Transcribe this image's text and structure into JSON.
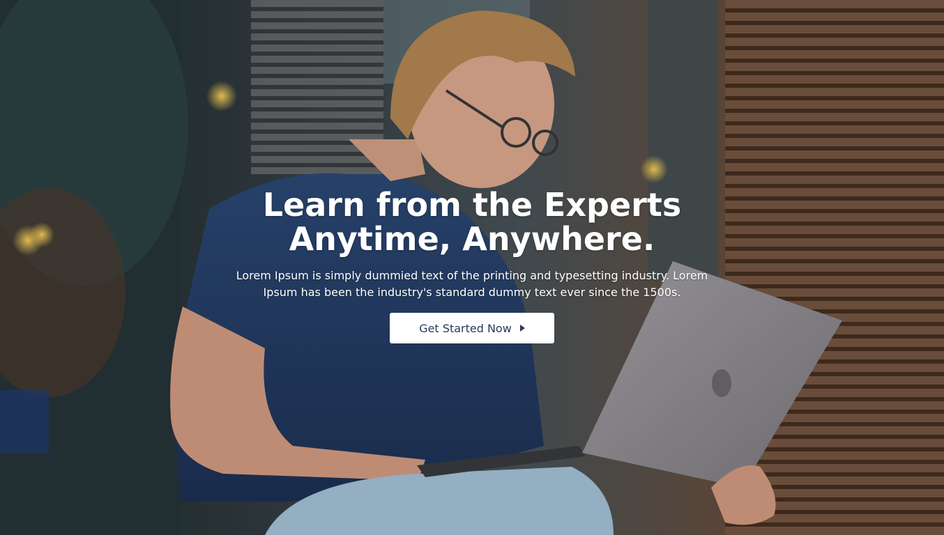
{
  "hero": {
    "headline_line1": "Learn from the Experts",
    "headline_line2": "Anytime, Anywhere.",
    "subtext_line1": "Lorem Ipsum is simply dummied text of the printing and typesetting industry. Lorem",
    "subtext_line2": "Ipsum has been the industry's standard dummy text ever since the 1500s.",
    "cta_label": "Get Started Now",
    "cta_icon": "caret-right-icon"
  },
  "colors": {
    "headline": "#ffffff",
    "button_bg": "#ffffff",
    "button_text": "#2a3a5c"
  }
}
